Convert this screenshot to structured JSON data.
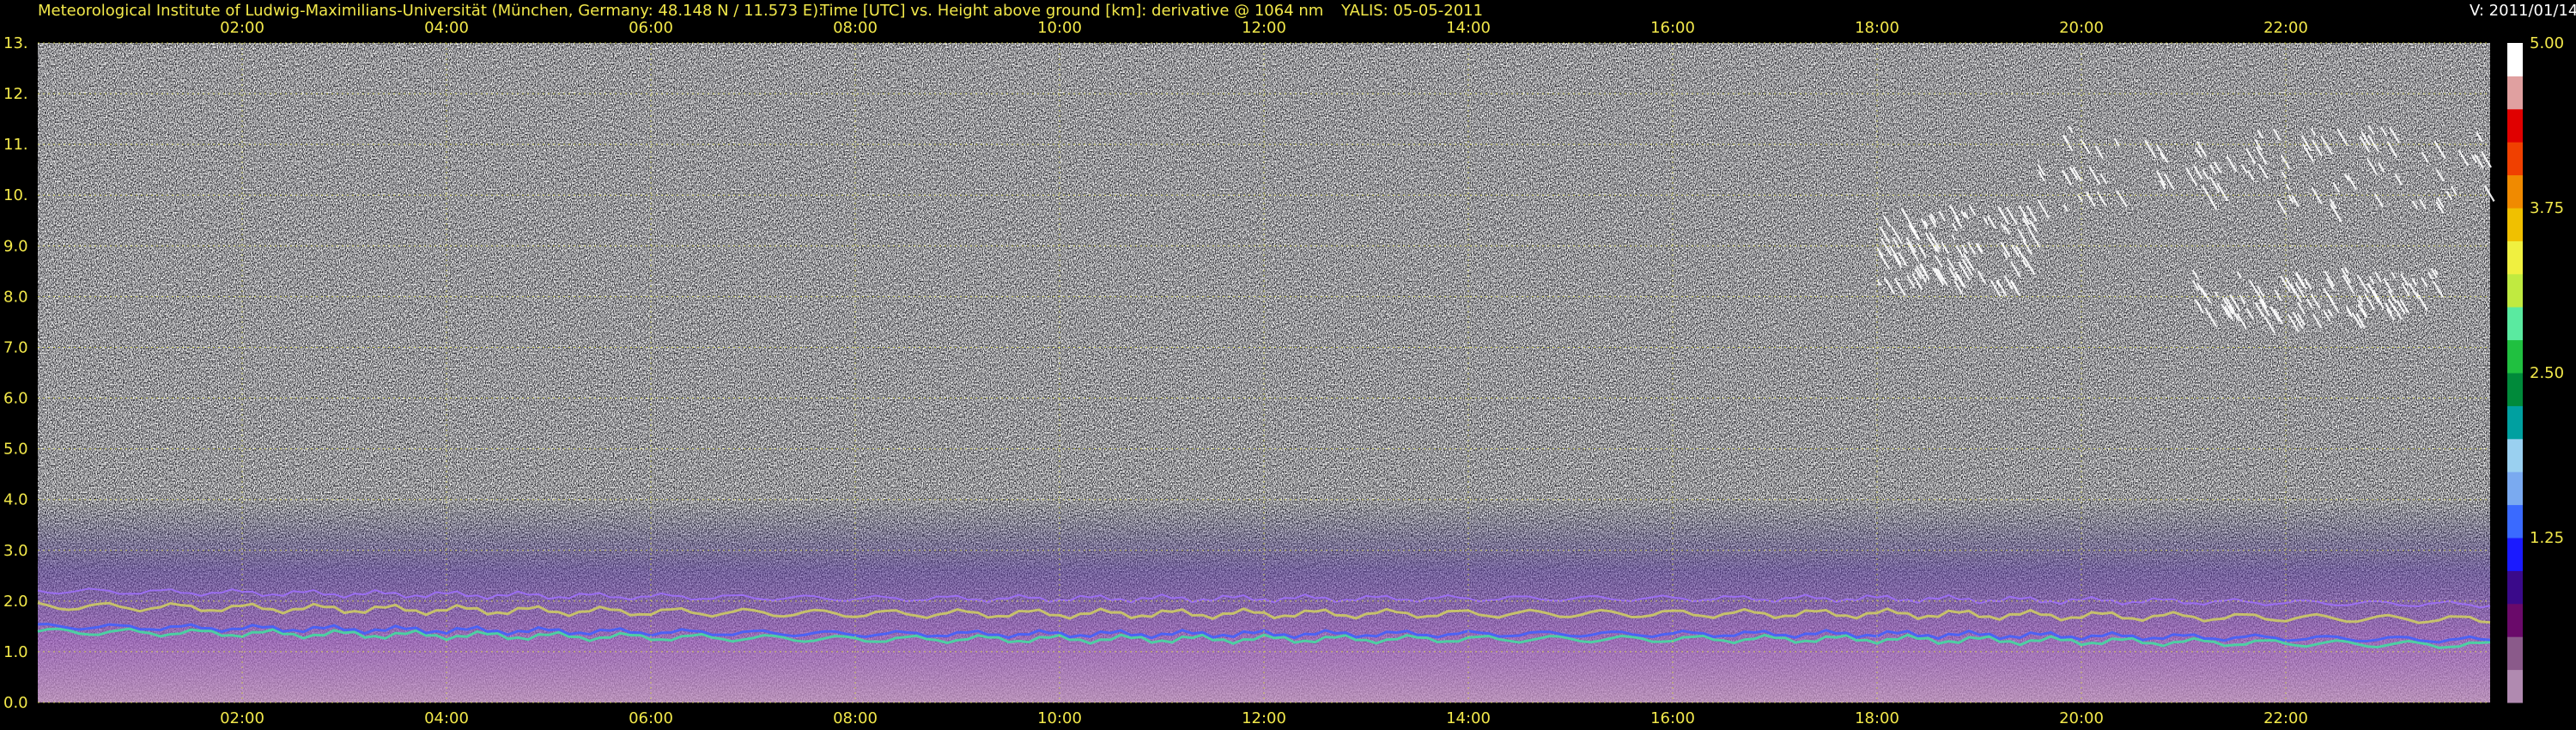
{
  "header": {
    "institute": "Meteorological Institute of Ludwig-Maximilians-Universität (München, Germany: 48.148 N / 11.573 E):",
    "plot_title": "Time [UTC] vs. Height above ground [km]: derivative @ 1064 nm",
    "instrument_date": "YALIS: 05-05-2011",
    "version": "V: 2011/01/14"
  },
  "colors": {
    "background": "#000000",
    "text": "#f2e84a",
    "grid": "#d8d84a",
    "version_text": "#ffffff"
  },
  "chart_data": {
    "type": "heatmap",
    "title": "Time [UTC] vs. Height above ground [km]: derivative @ 1064 nm",
    "xlabel": "Time [UTC]",
    "ylabel": "Height above ground [km]",
    "x_ticks": [
      "02:00",
      "04:00",
      "06:00",
      "08:00",
      "10:00",
      "12:00",
      "14:00",
      "16:00",
      "18:00",
      "20:00",
      "22:00"
    ],
    "x_tick_hours": [
      2,
      4,
      6,
      8,
      10,
      12,
      14,
      16,
      18,
      20,
      22
    ],
    "xlim_hours": [
      0,
      24
    ],
    "y_ticks": [
      "0.0",
      "1.0",
      "2.0",
      "3.0",
      "4.0",
      "5.0",
      "6.0",
      "7.0",
      "8.0",
      "9.0",
      "10.",
      "11.",
      "12.",
      "13."
    ],
    "y_tick_values": [
      0,
      1,
      2,
      3,
      4,
      5,
      6,
      7,
      8,
      9,
      10,
      11,
      12,
      13
    ],
    "ylim": [
      0,
      13
    ],
    "grid": true,
    "colorbar": {
      "range": [
        0,
        5
      ],
      "ticks": [
        "1.25",
        "2.50",
        "3.75",
        "5.00"
      ],
      "tick_values": [
        1.25,
        2.5,
        3.75,
        5.0
      ],
      "colors": [
        "#b08ab0",
        "#8a5a8a",
        "#6a0a6a",
        "#3a0a8a",
        "#1a1aff",
        "#3a6aff",
        "#7aaaf0",
        "#9ad0f0",
        "#00a0a0",
        "#008a3a",
        "#20c040",
        "#5aeaa0",
        "#c0ea40",
        "#f0f040",
        "#f0c000",
        "#f08a00",
        "#f04000",
        "#e00000",
        "#e0a0a0",
        "#ffffff"
      ]
    },
    "features": [
      {
        "kind": "boundary_layer",
        "height_range_km": [
          0.5,
          2.5
        ],
        "time_range_hours": [
          0,
          24
        ]
      },
      {
        "kind": "cirrus_cloud",
        "height_range_km": [
          7.5,
          11.5
        ],
        "time_range_hours": [
          17.5,
          24
        ]
      }
    ]
  }
}
